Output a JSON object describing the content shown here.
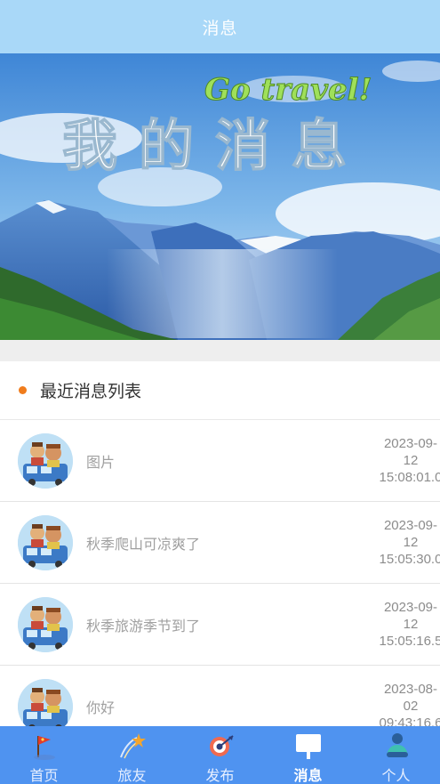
{
  "header": {
    "title": "消息"
  },
  "banner": {
    "title_text": "我的消息",
    "slogan_text": "Go travel!"
  },
  "section": {
    "title": "最近消息列表"
  },
  "messages": [
    {
      "text": "图片",
      "date": "2023-09-",
      "day": "12",
      "time": "15:08:01.0"
    },
    {
      "text": "秋季爬山可凉爽了",
      "date": "2023-09-",
      "day": "12",
      "time": "15:05:30.0"
    },
    {
      "text": "秋季旅游季节到了",
      "date": "2023-09-",
      "day": "12",
      "time": "15:05:16.5"
    },
    {
      "text": "你好",
      "date": "2023-08-",
      "day": "02",
      "time": "09:43:16.6"
    }
  ],
  "tabs": [
    {
      "label": "首页",
      "icon": "home-flag-icon"
    },
    {
      "label": "旅友",
      "icon": "shooting-star-icon"
    },
    {
      "label": "发布",
      "icon": "publish-target-icon"
    },
    {
      "label": "消息",
      "icon": "message-board-icon",
      "active": true
    },
    {
      "label": "个人",
      "icon": "person-icon"
    }
  ],
  "colors": {
    "header": "#a9d8f8",
    "tabbar": "#4f93f0",
    "accent_dot": "#f07c1c"
  }
}
